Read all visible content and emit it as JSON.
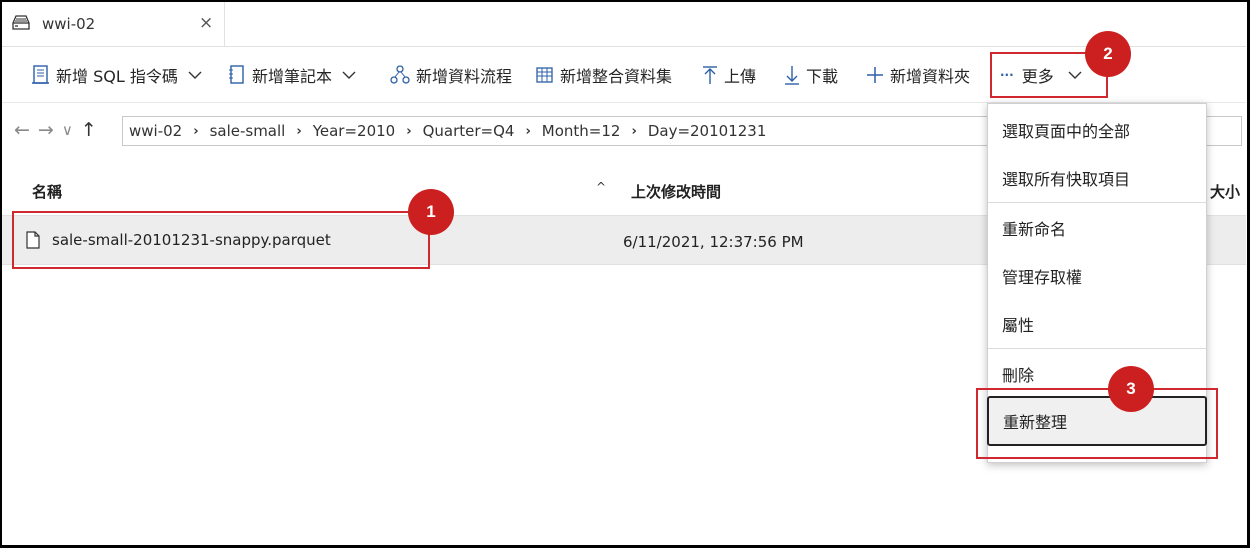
{
  "tab": {
    "title": "wwi-02",
    "icon": "storage-icon",
    "close": "×"
  },
  "toolbar": {
    "new_sql": "新增 SQL 指令碼",
    "new_notebook": "新增筆記本",
    "new_dataflow": "新增資料流程",
    "new_dataset": "新增整合資料集",
    "upload": "上傳",
    "download": "下載",
    "new_folder": "新增資料夾",
    "more": "更多",
    "more_dots": "···"
  },
  "nav": {
    "back": "←",
    "forward": "→",
    "down": "∨",
    "up": "↑"
  },
  "breadcrumb": [
    "wwi-02",
    "sale-small",
    "Year=2010",
    "Quarter=Q4",
    "Month=12",
    "Day=20101231"
  ],
  "list": {
    "headers": {
      "name": "名稱",
      "modified": "上次修改時間",
      "size": "大小",
      "sort": "^"
    },
    "rows": [
      {
        "name": "sale-small-20101231-snappy.parquet",
        "modified": "6/11/2021, 12:37:56 PM"
      }
    ]
  },
  "menu": {
    "items": [
      {
        "label": "選取頁面中的全部"
      },
      {
        "label": "選取所有快取項目"
      },
      {
        "label": "重新命名"
      },
      {
        "label": "管理存取權"
      },
      {
        "label": "屬性"
      },
      {
        "label": "刪除"
      },
      {
        "label": "重新整理"
      }
    ]
  },
  "badges": [
    "1",
    "2",
    "3"
  ],
  "colors": {
    "highlight": "#d0282e",
    "badge": "#cc1f1f",
    "accent": "#2d5fa8"
  }
}
